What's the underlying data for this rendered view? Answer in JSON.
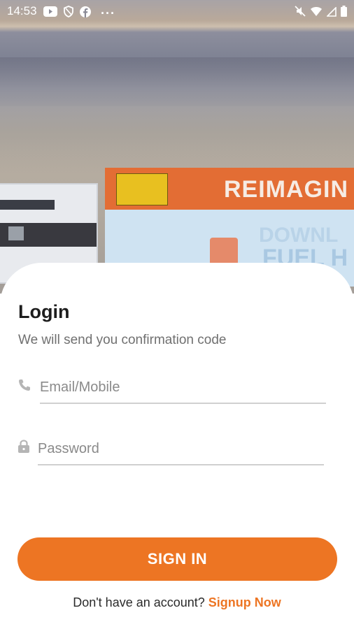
{
  "status_bar": {
    "time": "14:53",
    "more": "···"
  },
  "hero": {
    "ad_line1": "REIMAGIN",
    "ad_line2": "DOWNL",
    "ad_line3": "FUEL H"
  },
  "login": {
    "title": "Login",
    "subtitle": "We will send you confirmation code",
    "email_placeholder": "Email/Mobile",
    "email_value": "",
    "password_placeholder": "Password",
    "password_value": "",
    "signin_label": "SIGN IN",
    "signup_prompt": "Don't have an account? ",
    "signup_link": "Signup Now"
  },
  "colors": {
    "accent": "#ED7523",
    "text_primary": "#1D1D1D",
    "text_secondary": "#707070"
  },
  "icons": {
    "email_field": "phone-icon",
    "password_field": "lock-icon"
  }
}
